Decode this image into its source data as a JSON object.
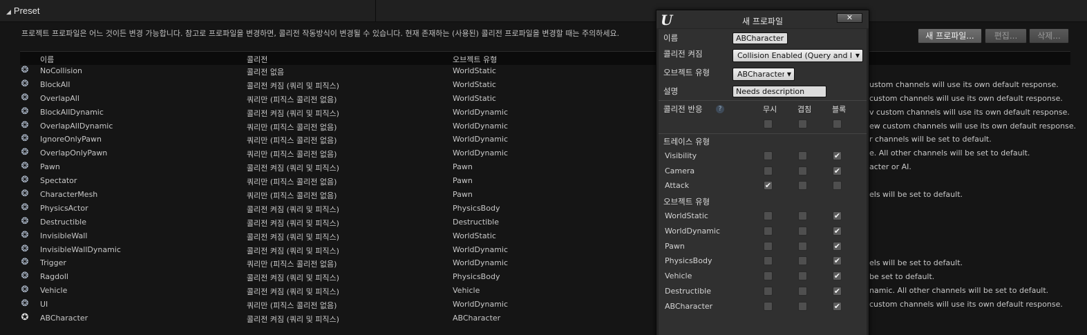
{
  "preset": {
    "title": "Preset",
    "description": "프로젝트 프로파일은 어느 것이든 변경 가능합니다. 참고로 프로파일을 변경하면, 콜리전 작동방식이 변경될 수 있습니다. 현재 존재하는 (사용된) 콜리전 프로파일을 변경할 때는 주의하세요.",
    "buttons": {
      "new": "새 프로파일...",
      "edit": "편집...",
      "delete": "삭제..."
    },
    "columns": {
      "name": "이름",
      "collision": "콜리전",
      "object_type": "오브젝트 유형"
    },
    "rows": [
      {
        "name": "NoCollision",
        "collision": "콜리전 없음",
        "type": "WorldStatic",
        "descr": "",
        "icon": "gear-icon"
      },
      {
        "name": "BlockAll",
        "collision": "콜리전 켜짐 (쿼리 및 피직스)",
        "type": "WorldStatic",
        "descr": "ustom channels will use its own default response.",
        "icon": "gear-icon"
      },
      {
        "name": "OverlapAll",
        "collision": "쿼리만 (피직스 콜리전 없음)",
        "type": "WorldStatic",
        "descr": "custom channels will use its own default response.",
        "icon": "gear-icon"
      },
      {
        "name": "BlockAllDynamic",
        "collision": "콜리전 켜짐 (쿼리 및 피직스)",
        "type": "WorldDynamic",
        "descr": "v custom channels will use its own default response.",
        "icon": "gear-icon"
      },
      {
        "name": "OverlapAllDynamic",
        "collision": "쿼리만 (피직스 콜리전 없음)",
        "type": "WorldDynamic",
        "descr": "ew custom channels will use its own default response.",
        "icon": "gear-icon"
      },
      {
        "name": "IgnoreOnlyPawn",
        "collision": "쿼리만 (피직스 콜리전 없음)",
        "type": "WorldDynamic",
        "descr": "r channels will be set to default.",
        "icon": "gear-icon"
      },
      {
        "name": "OverlapOnlyPawn",
        "collision": "쿼리만 (피직스 콜리전 없음)",
        "type": "WorldDynamic",
        "descr": "e. All other channels will be set to default.",
        "icon": "gear-icon"
      },
      {
        "name": "Pawn",
        "collision": "콜리전 켜짐 (쿼리 및 피직스)",
        "type": "Pawn",
        "descr": "acter or AI.",
        "icon": "gear-icon"
      },
      {
        "name": "Spectator",
        "collision": "쿼리만 (피직스 콜리전 없음)",
        "type": "Pawn",
        "descr": "",
        "icon": "gear-icon"
      },
      {
        "name": "CharacterMesh",
        "collision": "쿼리만 (피직스 콜리전 없음)",
        "type": "Pawn",
        "descr": "els will be set to default.",
        "icon": "gear-icon"
      },
      {
        "name": "PhysicsActor",
        "collision": "콜리전 켜짐 (쿼리 및 피직스)",
        "type": "PhysicsBody",
        "descr": "",
        "icon": "gear-icon"
      },
      {
        "name": "Destructible",
        "collision": "콜리전 켜짐 (쿼리 및 피직스)",
        "type": "Destructible",
        "descr": "",
        "icon": "gear-icon"
      },
      {
        "name": "InvisibleWall",
        "collision": "콜리전 켜짐 (쿼리 및 피직스)",
        "type": "WorldStatic",
        "descr": "",
        "icon": "gear-icon"
      },
      {
        "name": "InvisibleWallDynamic",
        "collision": "콜리전 켜짐 (쿼리 및 피직스)",
        "type": "WorldDynamic",
        "descr": "",
        "icon": "gear-icon"
      },
      {
        "name": "Trigger",
        "collision": "쿼리만 (피직스 콜리전 없음)",
        "type": "WorldDynamic",
        "descr": "els will be set to default.",
        "icon": "gear-icon"
      },
      {
        "name": "Ragdoll",
        "collision": "콜리전 켜짐 (쿼리 및 피직스)",
        "type": "PhysicsBody",
        "descr": "be set to default.",
        "icon": "gear-icon"
      },
      {
        "name": "Vehicle",
        "collision": "콜리전 켜짐 (쿼리 및 피직스)",
        "type": "Vehicle",
        "descr": "namic. All other channels will be set to default.",
        "icon": "gear-icon"
      },
      {
        "name": "UI",
        "collision": "쿼리만 (피직스 콜리전 없음)",
        "type": "WorldDynamic",
        "descr": "custom channels will use its own default response.",
        "icon": "gear-icon"
      },
      {
        "name": "ABCharacter",
        "collision": "콜리전 켜짐 (쿼리 및 피직스)",
        "type": "ABCharacter",
        "descr": "",
        "icon": "custom-profile-icon"
      }
    ]
  },
  "modal": {
    "title": "새 프로파일",
    "close_label": "✕",
    "logo_icon": "unreal-logo-icon",
    "fields": {
      "name_label": "이름",
      "name_value": "ABCharacter",
      "collision_label": "콜리전 켜짐",
      "collision_value": "Collision Enabled (Query and Physics)",
      "object_type_label": "오브젝트 유형",
      "object_type_value": "ABCharacter",
      "description_label": "설명",
      "description_value": "Needs description"
    },
    "response": {
      "label": "콜리전 반응",
      "help_icon": "help-icon",
      "col_ignore": "무시",
      "col_overlap": "겹침",
      "col_block": "블록",
      "all_state": [
        "off",
        "off",
        "off"
      ]
    },
    "trace_section": "트레이스 유형",
    "trace_channels": [
      {
        "name": "Visibility",
        "state": "block"
      },
      {
        "name": "Camera",
        "state": "block"
      },
      {
        "name": "Attack",
        "state": "ignore"
      }
    ],
    "object_section": "오브젝트 유형",
    "object_channels": [
      {
        "name": "WorldStatic",
        "state": "block"
      },
      {
        "name": "WorldDynamic",
        "state": "block"
      },
      {
        "name": "Pawn",
        "state": "block"
      },
      {
        "name": "PhysicsBody",
        "state": "block"
      },
      {
        "name": "Vehicle",
        "state": "block"
      },
      {
        "name": "Destructible",
        "state": "block"
      },
      {
        "name": "ABCharacter",
        "state": "block"
      }
    ]
  }
}
